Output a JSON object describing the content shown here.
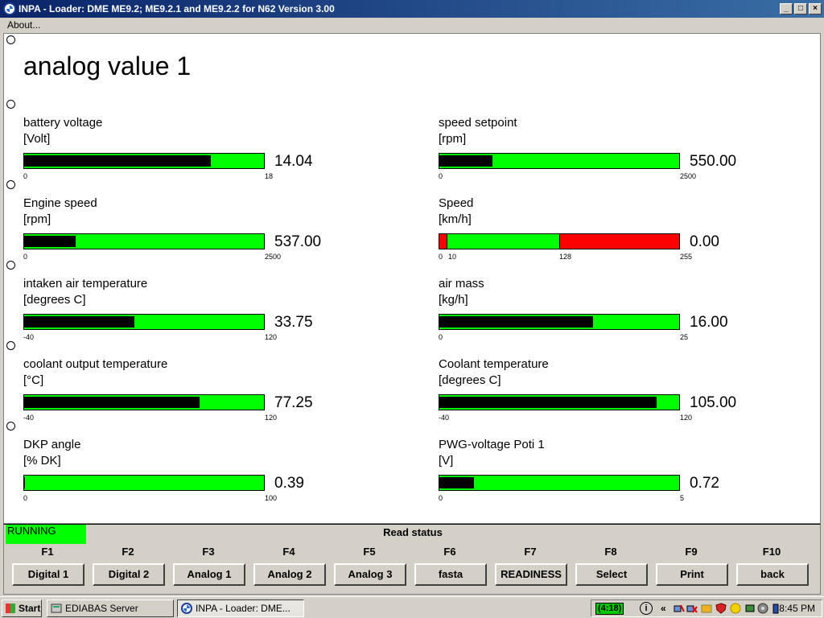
{
  "window": {
    "title": "INPA - Loader:  DME ME9.2; ME9.2.1 and ME9.2.2 for N62 Version 3.00",
    "controls": [
      "_",
      "□",
      "×"
    ]
  },
  "menu": {
    "about": "About..."
  },
  "page": {
    "title": "analog value 1"
  },
  "gauges": [
    {
      "label": "battery voltage",
      "unit": "[Volt]",
      "value": "14.04",
      "min": "0",
      "max": "18",
      "fraction": 0.78
    },
    {
      "label": "speed setpoint",
      "unit": "[rpm]",
      "value": "550.00",
      "min": "0",
      "max": "2500",
      "fraction": 0.22
    },
    {
      "label": "Engine speed",
      "unit": "[rpm]",
      "value": "537.00",
      "min": "0",
      "max": "2500",
      "fraction": 0.215
    },
    {
      "label": "Speed",
      "unit": "[km/h]",
      "value": "0.00",
      "min": "0",
      "mid1": "10",
      "mid2": "128",
      "max": "255",
      "fraction": 0
    },
    {
      "label": "intaken air temperature",
      "unit": "[degrees C]",
      "value": "33.75",
      "min": "-40",
      "max": "120",
      "fraction": 0.46
    },
    {
      "label": "air mass",
      "unit": "[kg/h]",
      "value": "16.00",
      "min": "0",
      "max": "25",
      "fraction": 0.64
    },
    {
      "label": "coolant output temperature",
      "unit": "[°C]",
      "value": "77.25",
      "min": "-40",
      "max": "120",
      "fraction": 0.73
    },
    {
      "label": "Coolant temperature",
      "unit": "[degrees C]",
      "value": "105.00",
      "min": "-40",
      "max": "120",
      "fraction": 0.906
    },
    {
      "label": "DKP angle",
      "unit": "[% DK]",
      "value": "0.39",
      "min": "0",
      "max": "100",
      "fraction": 0.004
    },
    {
      "label": "PWG-voltage Poti 1",
      "unit": "[V]",
      "value": "0.72",
      "min": "0",
      "max": "5",
      "fraction": 0.144
    }
  ],
  "status": {
    "running": "RUNNING",
    "read_status": "Read status"
  },
  "fkeys": [
    {
      "key": "F1",
      "label": "Digital 1"
    },
    {
      "key": "F2",
      "label": "Digital 2"
    },
    {
      "key": "F3",
      "label": "Analog 1"
    },
    {
      "key": "F4",
      "label": "Analog 2"
    },
    {
      "key": "F5",
      "label": "Analog 3"
    },
    {
      "key": "F6",
      "label": "fasta"
    },
    {
      "key": "F7",
      "label": "READINESS"
    },
    {
      "key": "F8",
      "label": "Select"
    },
    {
      "key": "F9",
      "label": "Print"
    },
    {
      "key": "F10",
      "label": "back"
    }
  ],
  "taskbar": {
    "start": "Start",
    "tasks": [
      "EDIABAS Server",
      "INPA - Loader:  DME..."
    ],
    "battery": "(4:18)",
    "tray_arrows": "«",
    "clock": "8:45 PM"
  },
  "colors": {
    "bar_green": "#00ff00",
    "bar_red": "#ff0000",
    "fill_black": "#000000",
    "titlebar": "#0a246a"
  }
}
